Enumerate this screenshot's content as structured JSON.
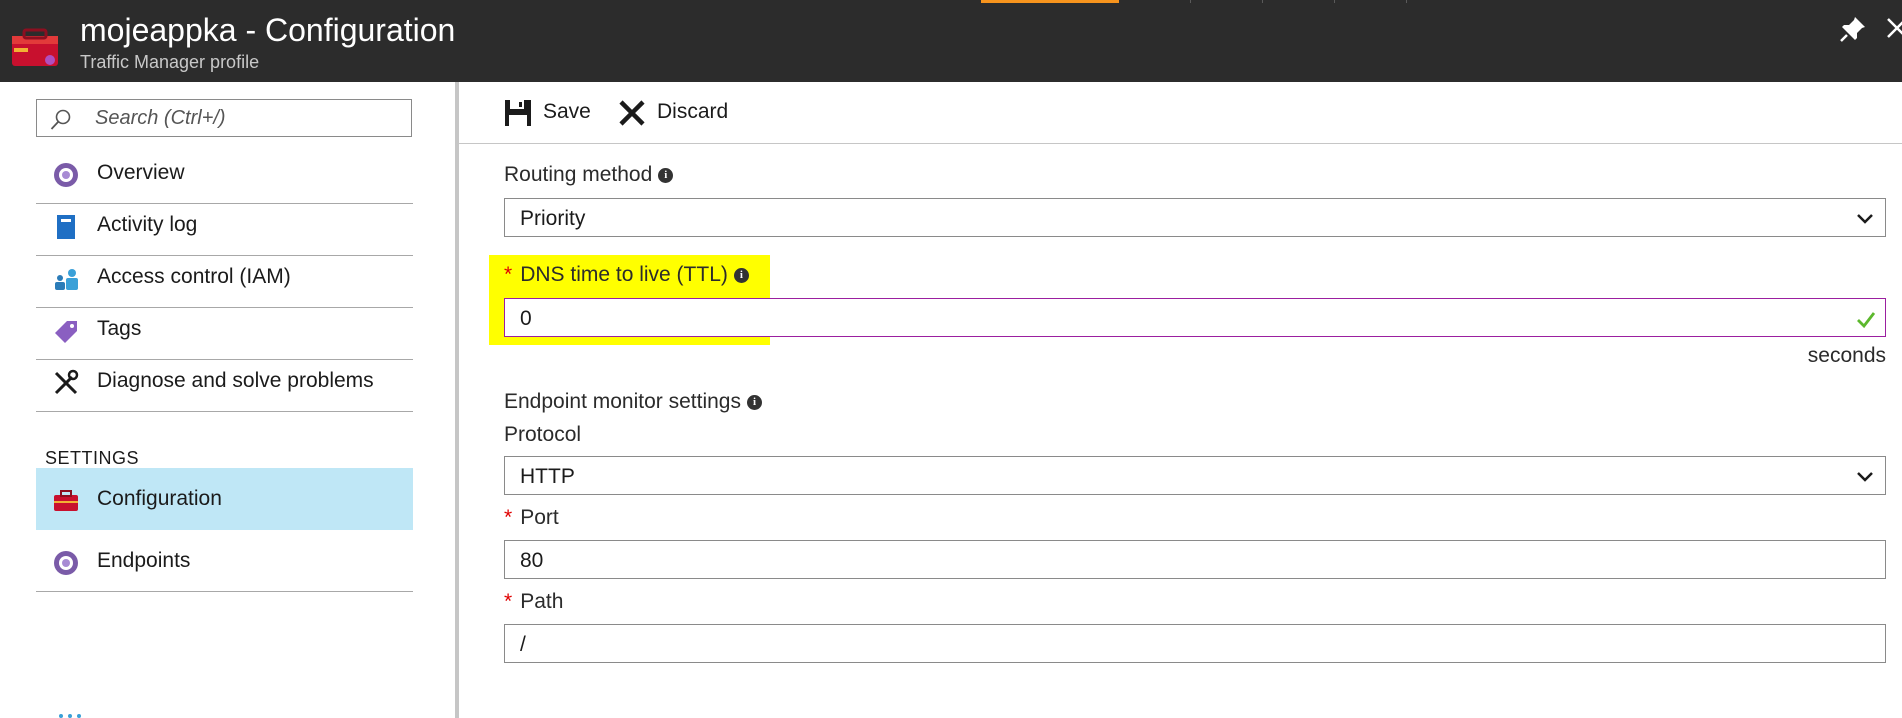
{
  "header": {
    "title": "mojeappka - Configuration",
    "subtitle": "Traffic Manager profile",
    "accent_color": "#f7941d",
    "icons": {
      "app": "toolbox-icon",
      "pin": "pin-icon",
      "close": "close-icon"
    }
  },
  "sidebar": {
    "search_placeholder": "Search (Ctrl+/)",
    "items": [
      {
        "label": "Overview",
        "icon": "traffic-manager-icon"
      },
      {
        "label": "Activity log",
        "icon": "activity-log-icon"
      },
      {
        "label": "Access control (IAM)",
        "icon": "people-icon"
      },
      {
        "label": "Tags",
        "icon": "tag-icon"
      },
      {
        "label": "Diagnose and solve problems",
        "icon": "wrench-icon"
      }
    ],
    "settings_header": "SETTINGS",
    "settings_items": [
      {
        "label": "Configuration",
        "icon": "toolbox-icon",
        "selected": true
      },
      {
        "label": "Endpoints",
        "icon": "traffic-manager-icon"
      }
    ],
    "selected_color": "#bfe7f6"
  },
  "toolbar": {
    "save_label": "Save",
    "discard_label": "Discard"
  },
  "form": {
    "routing_method": {
      "label": "Routing method",
      "value": "Priority"
    },
    "ttl": {
      "label": "DNS time to live (TTL)",
      "value": "0",
      "unit": "seconds",
      "required": true,
      "highlight_color": "#ffff00"
    },
    "endpoint_monitor": {
      "label": "Endpoint monitor settings"
    },
    "protocol": {
      "label": "Protocol",
      "value": "HTTP"
    },
    "port": {
      "label": "Port",
      "value": "80",
      "required": true
    },
    "path": {
      "label": "Path",
      "value": "/",
      "required": true
    },
    "required_marker": "*",
    "info_marker": "i"
  }
}
